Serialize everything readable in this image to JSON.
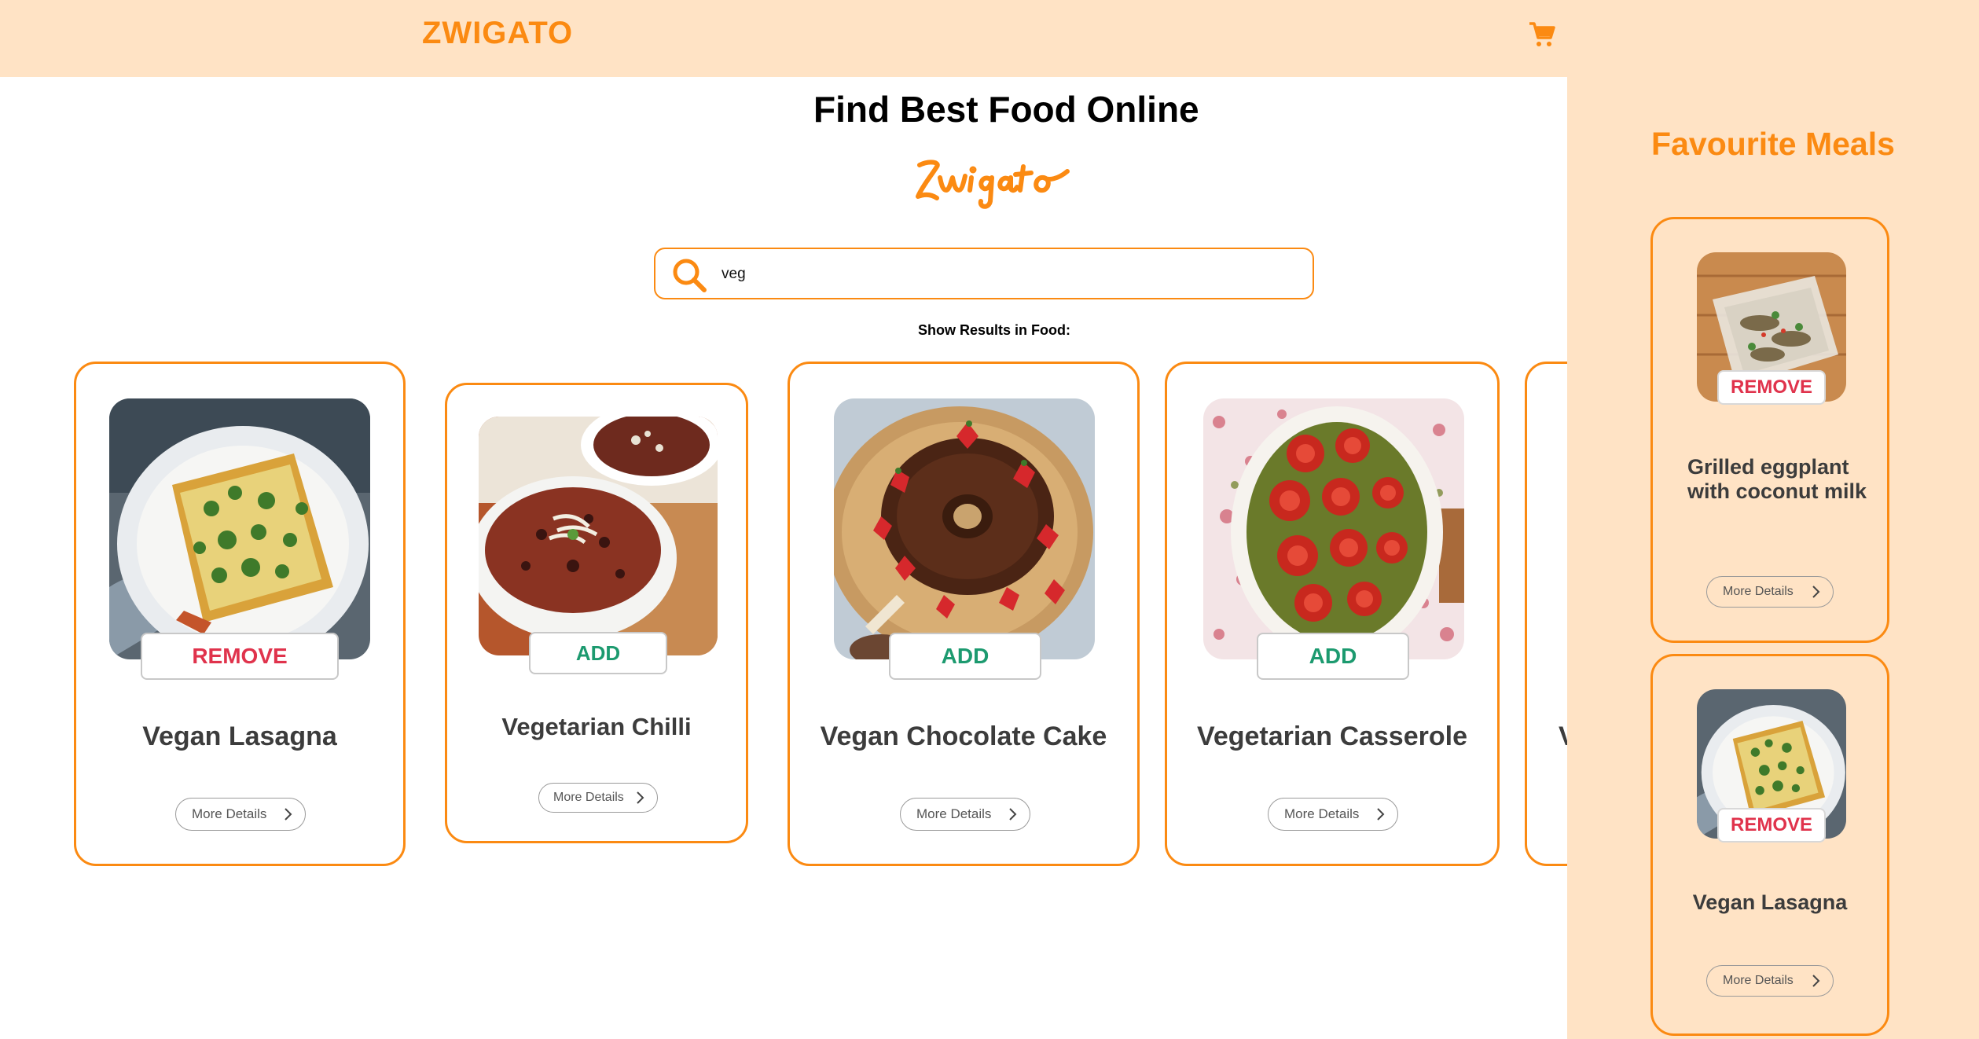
{
  "header": {
    "brand": "ZWIGATO",
    "cart_icon": "cart-icon"
  },
  "main": {
    "headline": "Find Best Food Online",
    "logo_text": "Zwigato",
    "search": {
      "value": "veg",
      "icon": "search-icon"
    },
    "results_label": "Show Results in Food:",
    "cards": [
      {
        "name": "Vegan Lasagna",
        "button": "REMOVE",
        "details": "More Details"
      },
      {
        "name": "Vegetarian Chilli",
        "button": "ADD",
        "details": "More Details"
      },
      {
        "name": "Vegan Chocolate Cake",
        "button": "ADD",
        "details": "More Details"
      },
      {
        "name": "Vegetarian Casserole",
        "button": "ADD",
        "details": "More Details"
      },
      {
        "name": "V",
        "button": "",
        "details": ""
      }
    ]
  },
  "sidebar": {
    "title": "Favourite Meals",
    "items": [
      {
        "name": "Grilled eggplant with coconut milk",
        "button": "REMOVE",
        "details": "More Details"
      },
      {
        "name": "Vegan Lasagna",
        "button": "REMOVE",
        "details": "More Details"
      }
    ]
  },
  "colors": {
    "accent": "#fb8a12",
    "peach": "#ffe3c5",
    "remove": "#e0334c",
    "add": "#1c9a6f"
  }
}
